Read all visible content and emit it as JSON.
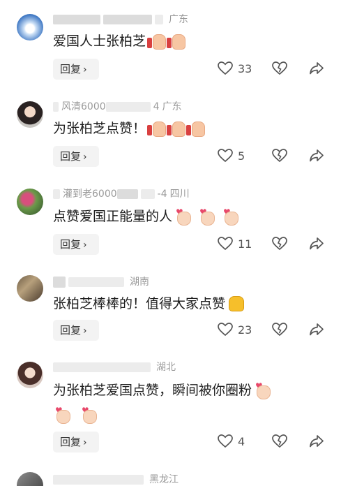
{
  "comments": [
    {
      "location": "广东",
      "text": "爱国人士张柏芝",
      "reply_label": "回复",
      "likes": "33"
    },
    {
      "meta_visible": "风清6000",
      "date_fragment": "4",
      "location": "广东",
      "text": "为张柏芝点赞！",
      "reply_label": "回复",
      "likes": "5"
    },
    {
      "meta_visible": "灌到老6000",
      "date_fragment": "-4",
      "location": "四川",
      "text": "点赞爱国正能量的人",
      "reply_label": "回复",
      "likes": "11"
    },
    {
      "location": "湖南",
      "text": "张柏芝棒棒的！值得大家点赞",
      "reply_label": "回复",
      "likes": "23"
    },
    {
      "location": "湖北",
      "text": "为张柏芝爱国点赞，瞬间被你圈粉",
      "reply_label": "回复",
      "likes": "4"
    },
    {
      "location": "黑龙江"
    }
  ],
  "icons": {
    "like": "heart-outline-icon",
    "dislike": "broken-heart-icon",
    "share": "share-arrow-icon",
    "emoji_thumbs": "thumbs-up-emoji-icon",
    "emoji_heart": "finger-heart-emoji-icon",
    "emoji_thumb_yellow": "yellow-thumbs-up-emoji-icon"
  },
  "colors": {
    "meta": "#9a9a9a",
    "reply_bg": "#f3f3f3",
    "icon": "#555555"
  }
}
